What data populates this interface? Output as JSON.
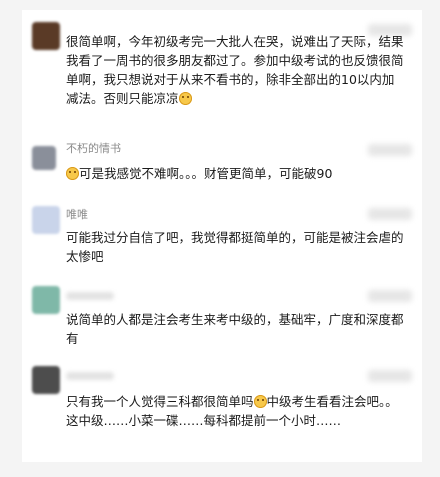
{
  "comments": [
    {
      "name": "",
      "text": "很简单啊，今年初级考完一大批人在哭，说难出了天际，结果我看了一周书的很多朋友都过了。参加中级考试的也反馈很简单啊，我只想说对于从来不看书的，除非全部出的10以内加减法。否则只能凉凉",
      "emoji_end": "cold-sweat-face-emoji",
      "avatar_color": "#5a3a26"
    },
    {
      "name": "不朽的情书",
      "text_a": "可是我感觉不难啊。。。财管更简单，可能破90",
      "emoji_start": "smile-face-emoji",
      "avatar_color": "#8a8f9a"
    },
    {
      "name": "唯唯",
      "text": "可能我过分自信了吧，我觉得都挺简单的，可能是被注会虐的太惨吧",
      "avatar_color": "#c9d4ea"
    },
    {
      "name": "",
      "text": "说简单的人都是注会考生来考中级的，基础牢，广度和深度都有",
      "avatar_color": "#7fb8a8"
    },
    {
      "name": "",
      "text_a": "只有我一个人觉得三科都很简单吗",
      "text_b": "中级考生看看注会吧。。这中级……小菜一碟……每科都提前一个小时……",
      "emoji_mid": "grin-sweat-face-emoji",
      "avatar_color": "#4d4d4d"
    }
  ]
}
